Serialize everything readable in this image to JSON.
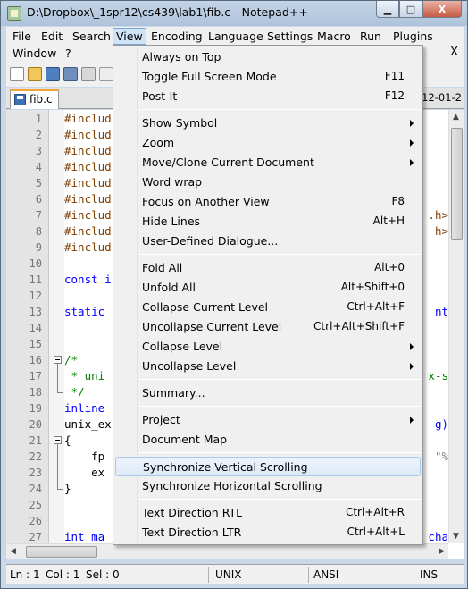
{
  "window": {
    "title": "D:\\Dropbox\\_1spr12\\cs439\\lab1\\fib.c - Notepad++",
    "min": "▁",
    "max": "□",
    "close": "X"
  },
  "menubar": {
    "items": [
      "File",
      "Edit",
      "Search",
      "View",
      "Encoding",
      "Language",
      "Settings",
      "Macro",
      "Run",
      "Plugins",
      "Window",
      "?"
    ],
    "active": "View",
    "close_doc": "X"
  },
  "tabs": {
    "active_tab": "fib.c",
    "right_text": "2012-01-2"
  },
  "editor": {
    "line_numbers": [
      "1",
      "2",
      "3",
      "4",
      "5",
      "6",
      "7",
      "8",
      "9",
      "10",
      "11",
      "12",
      "13",
      "14",
      "15",
      "16",
      "17",
      "18",
      "19",
      "20",
      "21",
      "22",
      "23",
      "24",
      "25",
      "26",
      "27"
    ],
    "code": [
      "#includ",
      "#includ",
      "#includ",
      "#includ",
      "#includ",
      "#includ",
      "#includ",
      "#includ",
      "#includ",
      "",
      "const i",
      "",
      "static",
      "",
      "",
      "/*",
      " * uni",
      " */",
      "inline",
      "unix_ex",
      "{",
      "    fp",
      "    ex",
      "}",
      "",
      "",
      "int ma"
    ],
    "right_fragments": {
      "7": ".h>",
      "8": "h>",
      "13": "nt",
      "17": "x-s",
      "20": "g)",
      "22": "\"%",
      "27": "cha"
    }
  },
  "view_menu": {
    "items": [
      {
        "label": "Always on Top",
        "shortcut": "",
        "submenu": false
      },
      {
        "label": "Toggle Full Screen Mode",
        "shortcut": "F11",
        "submenu": false
      },
      {
        "label": "Post-It",
        "shortcut": "F12",
        "submenu": false
      },
      {
        "sep": true
      },
      {
        "label": "Show Symbol",
        "shortcut": "",
        "submenu": true
      },
      {
        "label": "Zoom",
        "shortcut": "",
        "submenu": true
      },
      {
        "label": "Move/Clone Current Document",
        "shortcut": "",
        "submenu": true
      },
      {
        "label": "Word wrap",
        "shortcut": "",
        "submenu": false
      },
      {
        "label": "Focus on Another View",
        "shortcut": "F8",
        "submenu": false
      },
      {
        "label": "Hide Lines",
        "shortcut": "Alt+H",
        "submenu": false
      },
      {
        "label": "User-Defined Dialogue...",
        "shortcut": "",
        "submenu": false
      },
      {
        "sep": true
      },
      {
        "label": "Fold All",
        "shortcut": "Alt+0",
        "submenu": false
      },
      {
        "label": "Unfold All",
        "shortcut": "Alt+Shift+0",
        "submenu": false
      },
      {
        "label": "Collapse Current Level",
        "shortcut": "Ctrl+Alt+F",
        "submenu": false
      },
      {
        "label": "Uncollapse Current Level",
        "shortcut": "Ctrl+Alt+Shift+F",
        "submenu": false
      },
      {
        "label": "Collapse Level",
        "shortcut": "",
        "submenu": true
      },
      {
        "label": "Uncollapse Level",
        "shortcut": "",
        "submenu": true
      },
      {
        "sep": true
      },
      {
        "label": "Summary...",
        "shortcut": "",
        "submenu": false
      },
      {
        "sep": true
      },
      {
        "label": "Project",
        "shortcut": "",
        "submenu": true
      },
      {
        "label": "Document Map",
        "shortcut": "",
        "submenu": false
      },
      {
        "sep": true
      },
      {
        "label": "Synchronize Vertical Scrolling",
        "shortcut": "",
        "submenu": false,
        "highlighted": true
      },
      {
        "label": "Synchronize Horizontal Scrolling",
        "shortcut": "",
        "submenu": false
      },
      {
        "sep": true
      },
      {
        "label": "Text Direction RTL",
        "shortcut": "Ctrl+Alt+R",
        "submenu": false
      },
      {
        "label": "Text Direction LTR",
        "shortcut": "Ctrl+Alt+L",
        "submenu": false
      }
    ]
  },
  "statusbar": {
    "ln": "Ln : 1",
    "col": "Col : 1",
    "sel": "Sel : 0",
    "eol": "UNIX",
    "encoding": "ANSI",
    "mode": "INS"
  },
  "colors": {
    "directive": "#804000",
    "keyword": "#0000ff",
    "comment": "#008000",
    "highlight": "#dde9f7",
    "tab_accent": "#f3a43a"
  }
}
